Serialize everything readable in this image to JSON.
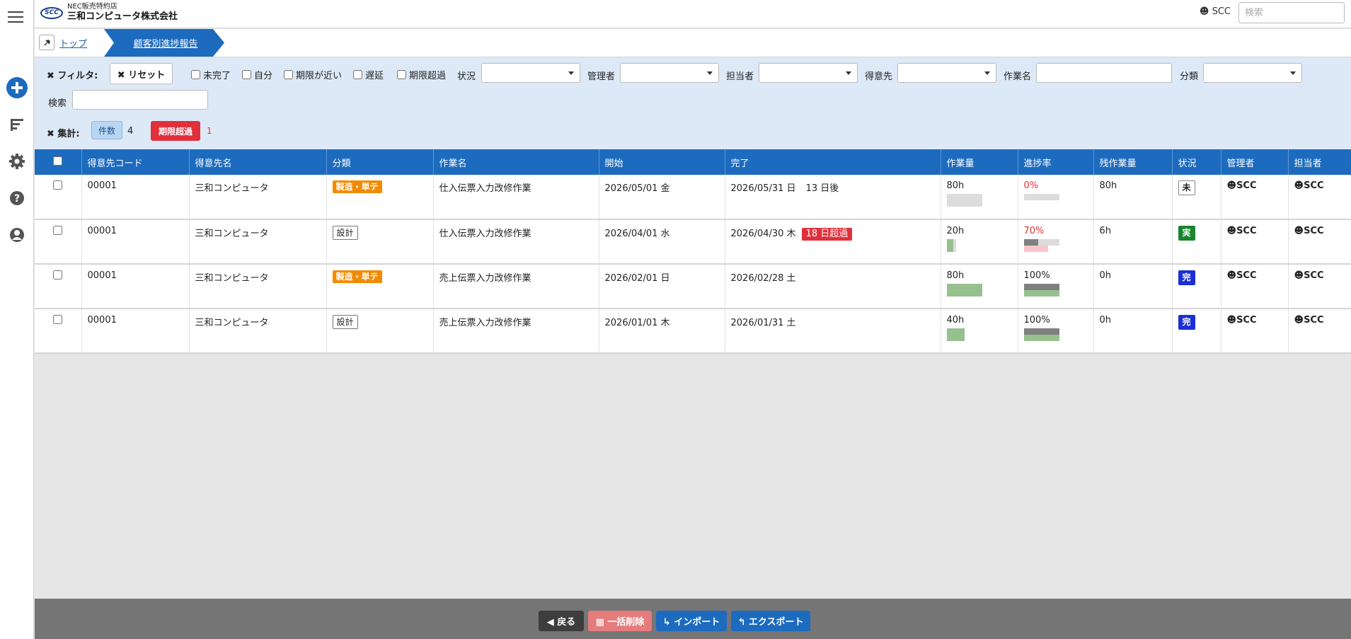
{
  "colors": {
    "primary": "#1c6bbf",
    "overdue": "#e0303b",
    "category_orange": "#f28a00",
    "status_done": "#1b2fd6",
    "status_in_progress": "#18862d"
  },
  "header": {
    "logo_mark": "SCC",
    "logo_subtitle": "NEC販売特約店",
    "logo_title": "三和コンピュータ株式会社",
    "user": "SCC",
    "search_placeholder": "検索"
  },
  "sidebar": {
    "icons": [
      "menu-icon",
      "add-icon",
      "gantt-icon",
      "gear-icon",
      "help-icon",
      "user-icon"
    ]
  },
  "breadcrumb": {
    "top": "トップ",
    "current": "顧客別進捗報告"
  },
  "filter": {
    "label": "✖ フィルタ:",
    "reset": "✖ リセット",
    "checkboxes": [
      "未完了",
      "自分",
      "期限が近い",
      "遅延",
      "期限超過"
    ],
    "status_label": "状況",
    "manager_label": "管理者",
    "assignee_label": "担当者",
    "customer_label": "得意先",
    "task_label": "作業名",
    "category_label": "分類",
    "search_label": "検索"
  },
  "summary": {
    "label": "✖ 集計:",
    "count_label": "件数",
    "count_value": "4",
    "overdue_label": "期限超過",
    "overdue_value": "1"
  },
  "table": {
    "headers": [
      "得意先コード",
      "得意先名",
      "分類",
      "作業名",
      "開始",
      "完了",
      "作業量",
      "進捗率",
      "残作業量",
      "状況",
      "管理者",
      "担当者"
    ],
    "rows": [
      {
        "code": "00001",
        "customer": "三和コンピュータ",
        "category": "製造・単テ",
        "task": "仕入伝票入力改修作業",
        "start": "2026/05/01 金",
        "end": "2026/05/31 日",
        "end_note": "13 日後",
        "end_overdue": "",
        "workload": "80h",
        "workload_done": 0,
        "progress": "0%",
        "progress_value": 0,
        "remaining": "80h",
        "status": "未",
        "manager": "SCC",
        "assignee": "SCC"
      },
      {
        "code": "00001",
        "customer": "三和コンピュータ",
        "category": "設計",
        "task": "仕入伝票入力改修作業",
        "start": "2026/04/01 水",
        "end": "2026/04/30 木",
        "end_note": "",
        "end_overdue": "18 日超過",
        "workload": "20h",
        "workload_done": 0.7,
        "progress": "70%",
        "progress_value": 0.7,
        "remaining": "6h",
        "status": "実",
        "manager": "SCC",
        "assignee": "SCC"
      },
      {
        "code": "00001",
        "customer": "三和コンピュータ",
        "category": "製造・単テ",
        "task": "売上伝票入力改修作業",
        "start": "2026/02/01 日",
        "end": "2026/02/28 土",
        "end_note": "",
        "end_overdue": "",
        "workload": "80h",
        "workload_done": 1,
        "progress": "100%",
        "progress_value": 1,
        "remaining": "0h",
        "status": "完",
        "manager": "SCC",
        "assignee": "SCC"
      },
      {
        "code": "00001",
        "customer": "三和コンピュータ",
        "category": "設計",
        "task": "売上伝票入力改修作業",
        "start": "2026/01/01 木",
        "end": "2026/01/31 土",
        "end_note": "",
        "end_overdue": "",
        "workload": "40h",
        "workload_done": 1,
        "progress": "100%",
        "progress_value": 1,
        "remaining": "0h",
        "status": "完",
        "manager": "SCC",
        "assignee": "SCC"
      }
    ]
  },
  "footer": {
    "back": "戻る",
    "bulk_delete": "一括削除",
    "import": "インポート",
    "export": "エクスポート"
  }
}
